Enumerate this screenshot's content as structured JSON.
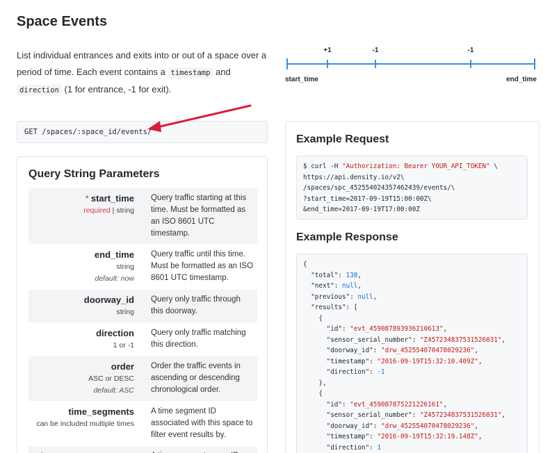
{
  "page": {
    "title": "Space Events"
  },
  "intro": {
    "part1": "List individual entrances and exits into or out of a space over a period of time. Each event contains a ",
    "code1": "timestamp",
    "part2": " and ",
    "code2": "direction",
    "part3": " (1 for entrance, -1 for exit)."
  },
  "timeline": {
    "ticks": [
      "+1",
      "-1",
      "-1"
    ],
    "start_label": "start_time",
    "end_label": "end_time",
    "accent": "#3b8fd9"
  },
  "endpoint": {
    "text": "GET /spaces/:space_id/events/"
  },
  "annotation": {
    "arrow_color": "#d81f3a"
  },
  "query_params": {
    "title": "Query String Parameters",
    "rows": [
      {
        "name": "start_time",
        "required_marker": "*",
        "required": "required",
        "sep": " | ",
        "type": "string",
        "default": "",
        "description": "Query traffic starting at this time. Must be formatted as an ISO 8601 UTC timestamp."
      },
      {
        "name": "end_time",
        "type": "string",
        "default": "default: now",
        "description": "Query traffic until this time. Must be formatted as an ISO 8601 UTC timestamp."
      },
      {
        "name": "doorway_id",
        "type": "string",
        "default": "",
        "description": "Query only traffic through this doorway."
      },
      {
        "name": "direction",
        "type": "1 or -1",
        "default": "",
        "description": "Query only traffic matching this direction."
      },
      {
        "name": "order",
        "type": "ASC or DESC",
        "default": "default: ASC",
        "description": "Order the traffic events in ascending or descending chronological order."
      },
      {
        "name": "time_segments",
        "type": "can be included multiple times",
        "default": "",
        "description": "A time segment ID associated with this space to filter event results by."
      },
      {
        "name": "time_segment_groups",
        "type": "",
        "default": "",
        "description": "A time segment group ID"
      }
    ]
  },
  "example_request": {
    "title": "Example Request",
    "line1_prefix": "$ curl -H ",
    "line1_header": "\"Authorization: Bearer YOUR_API_TOKEN\"",
    "line1_suffix": " \\",
    "line2": "https://api.density.io/v2\\",
    "line3": "/spaces/spc_452554024357462439/events/\\",
    "line4": "?start_time=2017-09-19T15:00:00Z\\",
    "line5": "&end_time=2017-09-19T17:00:00Z"
  },
  "example_response": {
    "title": "Example Response",
    "open_brace": "{",
    "total_key": "\"total\"",
    "total_val": "138",
    "next_key": "\"next\"",
    "next_val": "null",
    "previous_key": "\"previous\"",
    "previous_val": "null",
    "results_key": "\"results\"",
    "results": [
      {
        "id": "\"evt_459087893936210613\"",
        "sensor_serial_number": "\"Z457234837531526031\"",
        "doorway_id": "\"drw_452554070478029236\"",
        "timestamp": "\"2016-09-19T15:32:10.409Z\"",
        "direction": "-1"
      },
      {
        "id": "\"evt_459087875221226161\"",
        "sensor_serial_number": "\"Z457234837531526031\"",
        "doorway_id": "\"drw_452554070478029236\"",
        "timestamp": "\"2016-09-19T15:32:19.148Z\"",
        "direction": "1"
      }
    ],
    "k_id": "\"id\"",
    "k_sensor": "\"sensor_serial_number\"",
    "k_doorway": "\"doorway_id\"",
    "k_timestamp": "\"timestamp\"",
    "k_direction": "\"direction\""
  }
}
